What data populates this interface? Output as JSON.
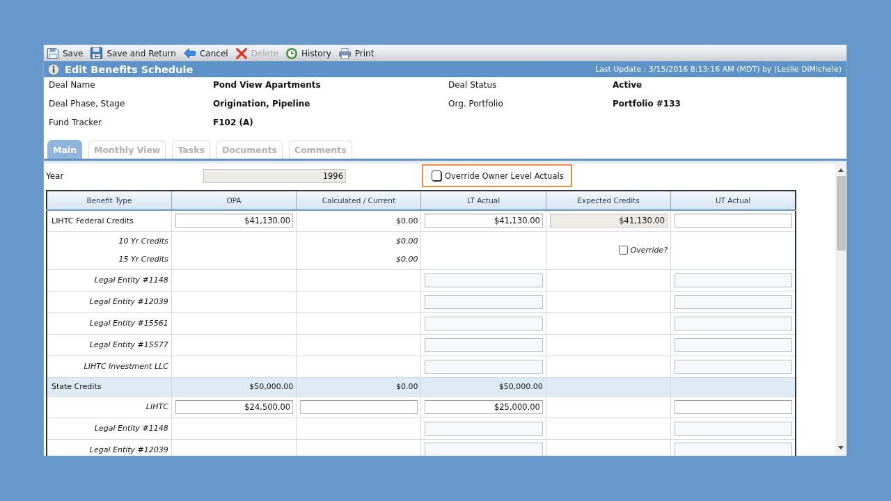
{
  "toolbar": [
    {
      "kind": "save",
      "label": "Save",
      "disabled": false
    },
    {
      "kind": "return",
      "label": "Save and Return",
      "disabled": false
    },
    {
      "kind": "cancel",
      "label": "Cancel",
      "disabled": false
    },
    {
      "kind": "delete",
      "label": "Delete",
      "disabled": true
    },
    {
      "kind": "history",
      "label": "History",
      "disabled": false
    },
    {
      "kind": "print",
      "label": "Print",
      "disabled": false
    }
  ],
  "header": {
    "title": "Edit Benefits Schedule",
    "last_update": "Last Update : 3/15/2016 8:13:16 AM (MDT) by (Leslie DiMichele)"
  },
  "details": [
    {
      "label": "Deal Name",
      "value": "Pond View Apartments"
    },
    {
      "label": "Deal Status",
      "value": "Active"
    },
    {
      "label": "Deal Phase, Stage",
      "value": "Origination, Pipeline"
    },
    {
      "label": "Org. Portfolio",
      "value": "Portfolio #133"
    },
    {
      "label": "Fund Tracker",
      "value": "F102 (A)"
    }
  ],
  "tabs": [
    {
      "label": "Main",
      "selected": true
    },
    {
      "label": "Monthly View",
      "selected": false
    },
    {
      "label": "Tasks",
      "selected": false
    },
    {
      "label": "Documents",
      "selected": false
    },
    {
      "label": "Comments",
      "selected": false
    }
  ],
  "year": {
    "label": "Year",
    "value": "1996"
  },
  "override": {
    "label": "Override Owner Level Actuals",
    "checked": false,
    "highlighted": true
  },
  "table": {
    "columns": [
      "Benefit Type",
      "OPA",
      "Calculated / Current",
      "LT Actual",
      "Expected Credits",
      "UT Actual"
    ],
    "rows": [
      {
        "kind": "group",
        "cells": [
          {
            "kind": "text",
            "text": "LIHTC Federal Credits"
          },
          {
            "kind": "input",
            "value": "$41,130.00"
          },
          {
            "kind": "text",
            "text": "$0.00"
          },
          {
            "kind": "input",
            "value": "$41,130.00"
          },
          {
            "kind": "readonly",
            "value": "$41,130.00"
          },
          {
            "kind": "input"
          }
        ]
      },
      {
        "kind": "detail",
        "cells": [
          {
            "kind": "lines",
            "lines": [
              "10 Yr Credits",
              "15 Yr Credits"
            ]
          },
          {
            "kind": "blank"
          },
          {
            "kind": "lines",
            "lines": [
              "$0.00",
              "$0.00"
            ]
          },
          {
            "kind": "blank"
          },
          {
            "kind": "checkbox",
            "label": "Override?",
            "checked": false
          },
          {
            "kind": "blank"
          }
        ]
      },
      {
        "kind": "detail",
        "cells": [
          {
            "kind": "text",
            "text": "Legal Entity #1148"
          },
          {
            "kind": "blank"
          },
          {
            "kind": "blank"
          },
          {
            "kind": "shaded"
          },
          {
            "kind": "blank"
          },
          {
            "kind": "shaded"
          }
        ]
      },
      {
        "kind": "detail",
        "cells": [
          {
            "kind": "text",
            "text": "Legal Entity #12039"
          },
          {
            "kind": "blank"
          },
          {
            "kind": "blank"
          },
          {
            "kind": "shaded"
          },
          {
            "kind": "blank"
          },
          {
            "kind": "shaded"
          }
        ]
      },
      {
        "kind": "detail",
        "cells": [
          {
            "kind": "text",
            "text": "Legal Entity #15561"
          },
          {
            "kind": "blank"
          },
          {
            "kind": "blank"
          },
          {
            "kind": "shaded"
          },
          {
            "kind": "blank"
          },
          {
            "kind": "shaded"
          }
        ]
      },
      {
        "kind": "detail",
        "cells": [
          {
            "kind": "text",
            "text": "Legal Entity #15577"
          },
          {
            "kind": "blank"
          },
          {
            "kind": "blank"
          },
          {
            "kind": "shaded"
          },
          {
            "kind": "blank"
          },
          {
            "kind": "shaded"
          }
        ]
      },
      {
        "kind": "detail",
        "cells": [
          {
            "kind": "text",
            "text": "LIHTC Investment LLC"
          },
          {
            "kind": "blank"
          },
          {
            "kind": "blank"
          },
          {
            "kind": "shaded"
          },
          {
            "kind": "blank"
          },
          {
            "kind": "shaded"
          }
        ]
      },
      {
        "kind": "summary",
        "cells": [
          {
            "kind": "text",
            "text": "State Credits"
          },
          {
            "kind": "text",
            "text": "$50,000.00"
          },
          {
            "kind": "text",
            "text": "$0.00"
          },
          {
            "kind": "text",
            "text": "$50,000.00"
          },
          {
            "kind": "blank"
          },
          {
            "kind": "blank"
          }
        ]
      },
      {
        "kind": "detail",
        "cells": [
          {
            "kind": "text",
            "text": "LIHTC"
          },
          {
            "kind": "input",
            "value": "$24,500.00"
          },
          {
            "kind": "input"
          },
          {
            "kind": "input",
            "value": "$25,000.00"
          },
          {
            "kind": "blank"
          },
          {
            "kind": "input"
          }
        ]
      },
      {
        "kind": "detail",
        "cells": [
          {
            "kind": "text",
            "text": "Legal Entity #1148"
          },
          {
            "kind": "blank"
          },
          {
            "kind": "blank"
          },
          {
            "kind": "shaded"
          },
          {
            "kind": "blank"
          },
          {
            "kind": "shaded"
          }
        ]
      },
      {
        "kind": "detail",
        "cells": [
          {
            "kind": "text",
            "text": "Legal Entity #12039"
          },
          {
            "kind": "blank"
          },
          {
            "kind": "blank"
          },
          {
            "kind": "shaded"
          },
          {
            "kind": "blank"
          },
          {
            "kind": "shaded"
          }
        ]
      }
    ]
  }
}
